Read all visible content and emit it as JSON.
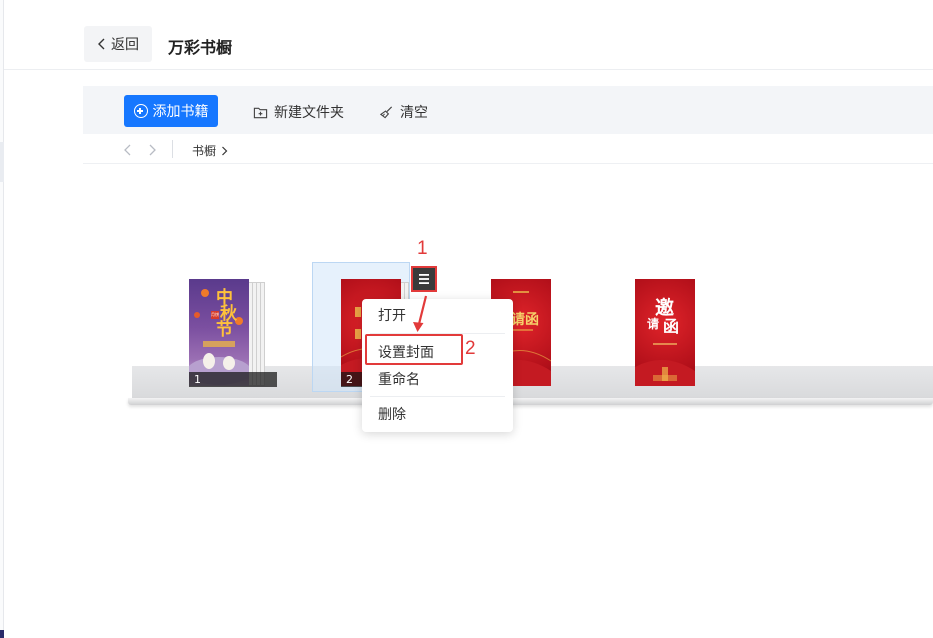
{
  "header": {
    "back_label": "返回",
    "title": "万彩书橱"
  },
  "toolbar": {
    "add_label": "添加书籍",
    "new_folder_label": "新建文件夹",
    "clear_label": "清空"
  },
  "pathbar": {
    "crumb": "书橱"
  },
  "books": [
    {
      "number": "1",
      "cover_text": [
        "中",
        "秋",
        "节"
      ],
      "badge": "月饼"
    },
    {
      "number": "2"
    },
    {
      "number": "",
      "cover_text": [
        "邀请函"
      ]
    },
    {
      "number": "",
      "cover_text": [
        "邀",
        "请",
        "函"
      ]
    }
  ],
  "context_menu": {
    "items": [
      "打开",
      "设置封面",
      "重命名",
      "删除"
    ]
  },
  "annotations": {
    "step1": "1",
    "step2": "2"
  },
  "colors": {
    "primary": "#1677ff",
    "annotation": "#e23a3a",
    "toolbar_bg": "#f3f5f8"
  }
}
